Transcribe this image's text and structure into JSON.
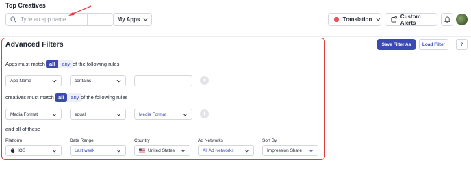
{
  "header": {
    "title": "Top Creatives",
    "search_placeholder": "Type an app name",
    "my_apps_label": "My Apps",
    "translation_label": "Translation",
    "custom_alerts_label": "Custom Alerts"
  },
  "panel": {
    "title": "Advanced Filters",
    "save_filter_label": "Save Filter As",
    "load_filter_label": "Load Filter",
    "help_label": "?"
  },
  "apps_rule": {
    "prefix": "Apps must match",
    "toggle_all": "all",
    "toggle_any": "any",
    "suffix": "of the following rules",
    "field": "App Name",
    "operator": "contains",
    "value": ""
  },
  "creatives_rule": {
    "prefix": "creatives must match",
    "toggle_all": "all",
    "toggle_any": "any",
    "suffix": "of the following rules",
    "field": "Media Format",
    "operator": "equal",
    "value": "Media Format"
  },
  "all_of_these": "and all of these",
  "filters": {
    "platform": {
      "label": "Platform",
      "value": "IOS",
      "icon": "apple-icon"
    },
    "date_range": {
      "label": "Date Range",
      "value": "Last week"
    },
    "country": {
      "label": "Country",
      "value": "United States",
      "icon": "us-flag-icon"
    },
    "ad_networks": {
      "label": "Ad Networks",
      "value": "All Ad Networks"
    },
    "sort_by": {
      "label": "Sort By",
      "value": "Impression Share"
    }
  },
  "colors": {
    "accent": "#3b4ab3",
    "highlight_border": "#e23b3b",
    "status_dot": "#e8505b"
  }
}
